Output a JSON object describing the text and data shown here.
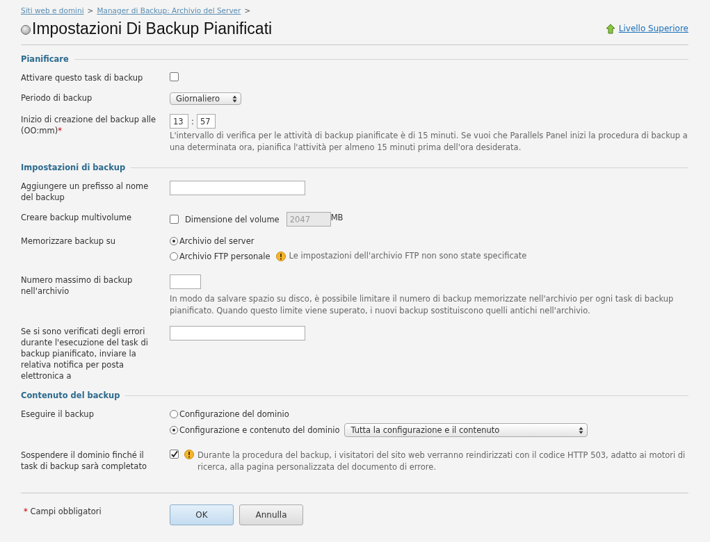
{
  "breadcrumbs": [
    {
      "label": "Siti web e domini",
      "separator": ">"
    },
    {
      "label": "Manager di Backup: Archivio del Server",
      "separator": ">"
    }
  ],
  "title": "Impostazioni Di Backup Pianificati",
  "up_link": "Livello Superiore",
  "sections": [
    {
      "title": "Pianificare",
      "rows": [
        {
          "label": "Attivare questo task di backup",
          "kind": "checkbox",
          "checked": false
        },
        {
          "label": "Periodo di backup",
          "kind": "select",
          "value": "Giornaliero"
        },
        {
          "label": "Inizio di creazione del backup alle (OO:mm)",
          "required_mark": "*",
          "kind": "time",
          "hours": "13",
          "separator": ":",
          "minutes": "57",
          "hint": "L'intervallo di verifica per le attività di backup pianificate è di 15 minuti. Se vuoi che Parallels Panel inizi la procedura di backup a una determinata ora, pianifica l'attività per almeno 15 minuti prima dell'ora desiderata."
        }
      ]
    },
    {
      "title": "Impostazioni di backup",
      "rows": [
        {
          "label": "Aggiungere un prefisso al nome del backup",
          "kind": "text"
        },
        {
          "label": "Creare backup multivolume",
          "kind": "volume",
          "checked": false,
          "option": "Dimensione del volume",
          "value": "2047",
          "disabled": true,
          "unit": "MB"
        },
        {
          "label": "Memorizzare backup su",
          "kind": "radio",
          "options": [
            {
              "label": "Archivio del server",
              "selected": true
            },
            {
              "label": "Archivio FTP personale",
              "selected": false,
              "warning": "Le impostazioni dell'archivio FTP non sono state specificate"
            }
          ]
        },
        {
          "label": "Numero massimo di backup nell'archivio",
          "kind": "short-text",
          "hint": "In modo da salvare spazio su disco, è possibile limitare il numero di backup memorizzate nell'archivio per ogni task di backup pianificato. Quando questo limite viene superato, i nuovi backup sostituiscono quelli antichi nell'archivio."
        },
        {
          "label": "Se si sono verificati degli errori durante l'esecuzione del task di backup pianificato, inviare la relativa notifica per posta elettronica a",
          "kind": "text"
        }
      ]
    },
    {
      "title": "Contenuto del backup",
      "rows": [
        {
          "label": "Eseguire il backup",
          "kind": "radio",
          "options": [
            {
              "label": "Configurazione del dominio",
              "selected": false
            },
            {
              "label": "Configurazione e contenuto del dominio",
              "selected": true,
              "select": "Tutta la configurazione e il contenuto"
            }
          ]
        },
        {
          "label": "Sospendere il dominio finché il task di backup sarà completato",
          "kind": "checkbox",
          "checked": true,
          "warning": "Durante la procedura del backup, i visitatori del sito web verranno reindirizzati con il codice HTTP 503, adatto ai motori di ricerca, alla pagina personalizzata del documento di errore."
        }
      ]
    }
  ],
  "footer": {
    "required_mark": "*",
    "label": "Campi obbligatori"
  },
  "buttons": [
    {
      "label": "OK",
      "kind": "primary"
    },
    {
      "label": "Annulla",
      "kind": "secondary"
    }
  ]
}
